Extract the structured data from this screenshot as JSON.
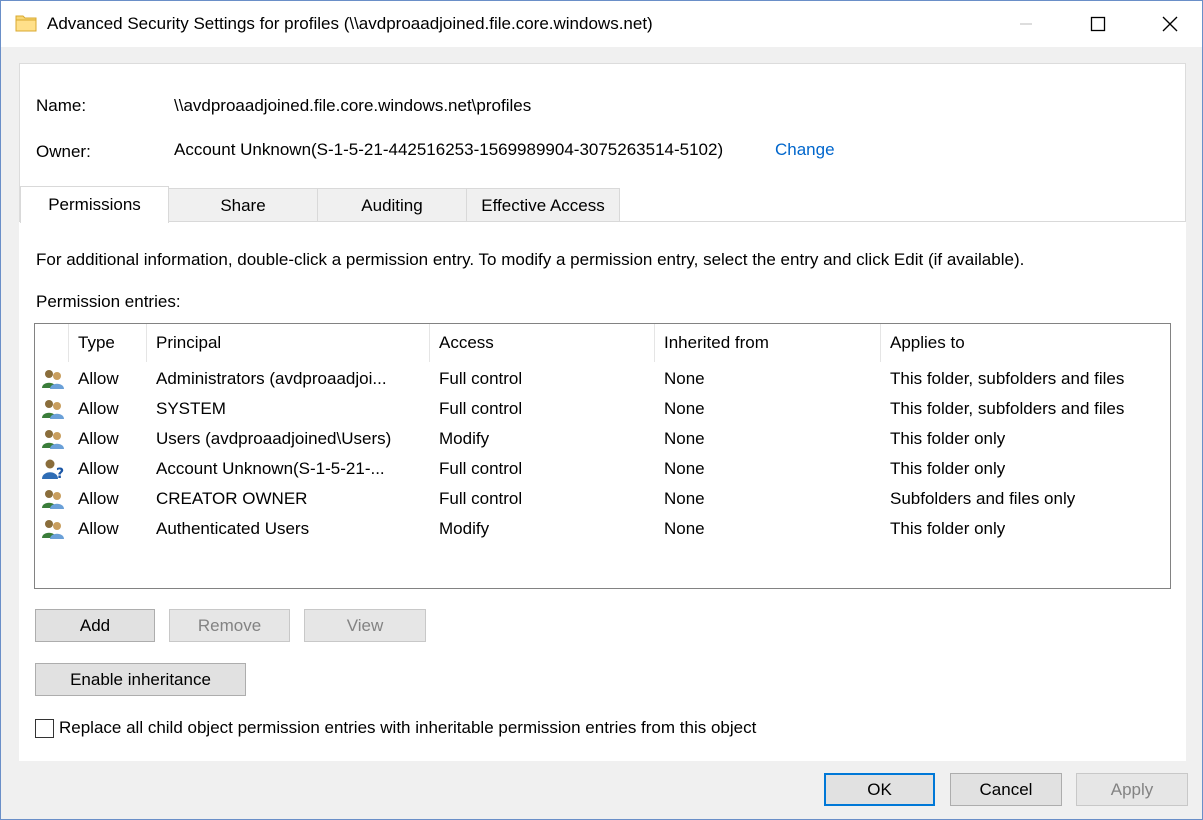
{
  "window": {
    "title": "Advanced Security Settings for profiles (\\\\avdproaadjoined.file.core.windows.net)"
  },
  "info": {
    "name_label": "Name:",
    "name_value": "\\\\avdproaadjoined.file.core.windows.net\\profiles",
    "owner_label": "Owner:",
    "owner_value": "Account Unknown(S-1-5-21-442516253-1569989904-3075263514-5102)",
    "change_link": "Change"
  },
  "tabs": [
    {
      "label": "Permissions",
      "active": true
    },
    {
      "label": "Share"
    },
    {
      "label": "Auditing"
    },
    {
      "label": "Effective Access"
    }
  ],
  "panel": {
    "instructions": "For additional information, double-click a permission entry. To modify a permission entry, select the entry and click Edit (if available).",
    "entries_label": "Permission entries:"
  },
  "table": {
    "columns": [
      "Type",
      "Principal",
      "Access",
      "Inherited from",
      "Applies to"
    ],
    "rows": [
      {
        "icon": "users-icon",
        "type": "Allow",
        "principal": "Administrators (avdproaadjoi...",
        "access": "Full control",
        "inherited": "None",
        "applies": "This folder, subfolders and files"
      },
      {
        "icon": "users-icon",
        "type": "Allow",
        "principal": "SYSTEM",
        "access": "Full control",
        "inherited": "None",
        "applies": "This folder, subfolders and files"
      },
      {
        "icon": "users-icon",
        "type": "Allow",
        "principal": "Users (avdproaadjoined\\Users)",
        "access": "Modify",
        "inherited": "None",
        "applies": "This folder only"
      },
      {
        "icon": "unknown-user-icon",
        "type": "Allow",
        "principal": "Account Unknown(S-1-5-21-...",
        "access": "Full control",
        "inherited": "None",
        "applies": "This folder only"
      },
      {
        "icon": "users-icon",
        "type": "Allow",
        "principal": "CREATOR OWNER",
        "access": "Full control",
        "inherited": "None",
        "applies": "Subfolders and files only"
      },
      {
        "icon": "users-icon",
        "type": "Allow",
        "principal": "Authenticated Users",
        "access": "Modify",
        "inherited": "None",
        "applies": "This folder only"
      }
    ]
  },
  "buttons": {
    "add": "Add",
    "remove": "Remove",
    "view": "View",
    "enable_inheritance": "Enable inheritance",
    "ok": "OK",
    "cancel": "Cancel",
    "apply": "Apply"
  },
  "replace_checkbox": {
    "label": "Replace all child object permission entries with inheritable permission entries from this object",
    "checked": false
  },
  "colors": {
    "link": "#0066cc",
    "default_button_border": "#0078d7"
  }
}
